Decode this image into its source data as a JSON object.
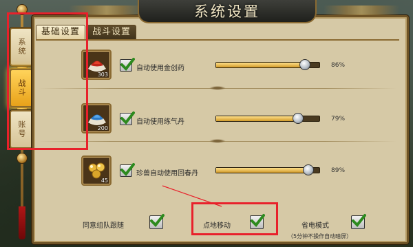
{
  "window": {
    "title": "系统设置"
  },
  "side_tabs": [
    {
      "label": "系统",
      "active": false
    },
    {
      "label": "战斗",
      "active": true
    },
    {
      "label": "账号",
      "active": false
    }
  ],
  "tabs": [
    {
      "label": "基础设置",
      "active": true
    },
    {
      "label": "战斗设置",
      "active": false
    }
  ],
  "auto_items": [
    {
      "icon": "red-powder-potion-icon",
      "count": "303",
      "checked": true,
      "label": "自动使用金创药",
      "percent": 86,
      "percent_label": "86%"
    },
    {
      "icon": "blue-powder-potion-icon",
      "count": "200",
      "checked": true,
      "label": "自动使用练气丹",
      "percent": 79,
      "percent_label": "79%"
    },
    {
      "icon": "gold-pill-icon",
      "count": "45",
      "checked": true,
      "label": "珍兽自动使用回春丹",
      "percent": 89,
      "percent_label": "89%"
    }
  ],
  "bottom_options": [
    {
      "label": "同意组队跟随",
      "checked": true
    },
    {
      "label": "点地移动",
      "checked": true
    },
    {
      "label": "省电模式",
      "checked": true,
      "note": "（5分钟不操作自动暗屏）"
    }
  ],
  "colors": {
    "highlight": "#e8212b",
    "panel": "#d6c9a6",
    "check_green": "#2d8a1e"
  }
}
